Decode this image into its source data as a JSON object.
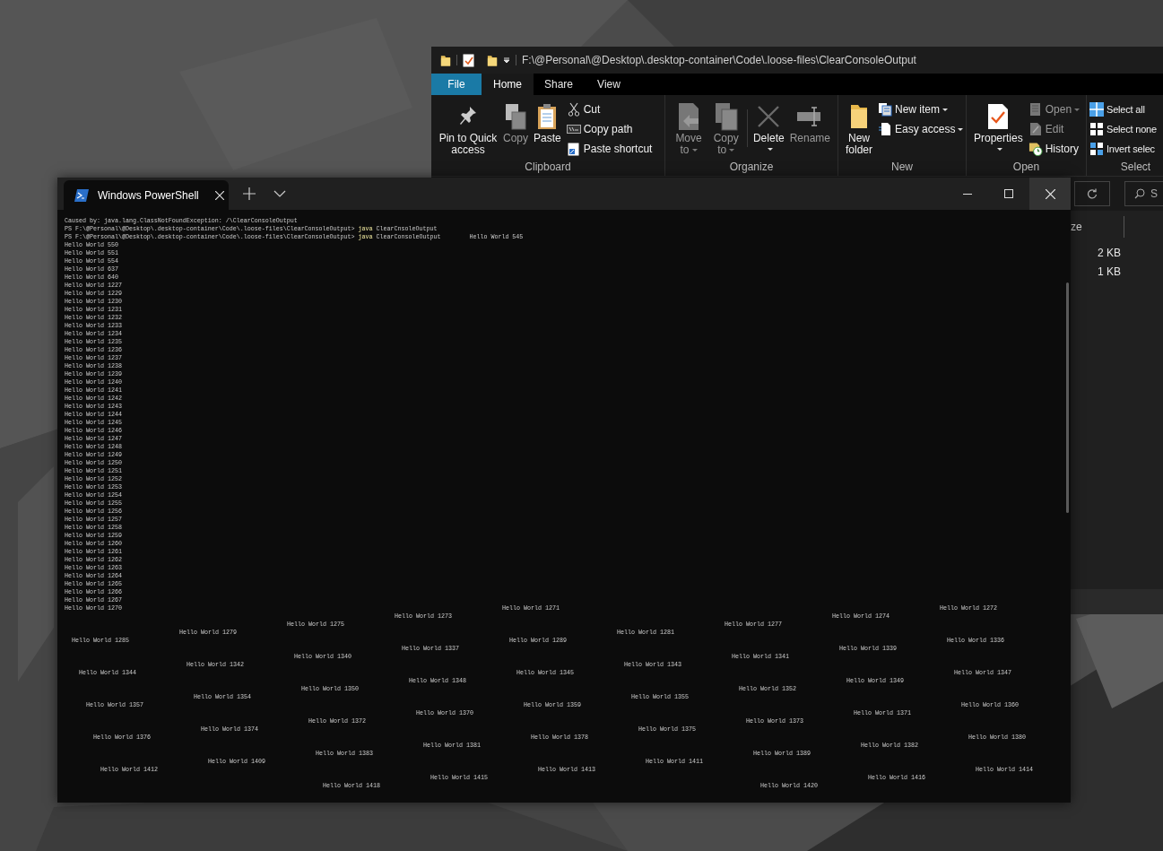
{
  "explorer": {
    "address": "F:\\@Personal\\@Desktop\\.desktop-container\\Code\\.loose-files\\ClearConsoleOutput",
    "tabs": [
      {
        "label": "File",
        "kind": "file",
        "selected": false
      },
      {
        "label": "Home",
        "kind": "tab",
        "selected": true
      },
      {
        "label": "Share",
        "kind": "tab",
        "selected": false
      },
      {
        "label": "View",
        "kind": "tab",
        "selected": false
      }
    ],
    "groups": [
      {
        "label": "Clipboard",
        "items": [
          {
            "label": "Pin to Quick access",
            "kind": "large",
            "disabled": false
          },
          {
            "label": "Copy",
            "kind": "large",
            "disabled": true
          },
          {
            "label": "Paste",
            "kind": "large",
            "disabled": false
          },
          {
            "label": "Cut",
            "kind": "small",
            "disabled": false
          },
          {
            "label": "Copy path",
            "kind": "small",
            "disabled": false
          },
          {
            "label": "Paste shortcut",
            "kind": "small",
            "disabled": false
          }
        ]
      },
      {
        "label": "Organize",
        "items": [
          {
            "label": "Move to",
            "kind": "large",
            "disabled": true,
            "dropdown": true
          },
          {
            "label": "Copy to",
            "kind": "large",
            "disabled": true,
            "dropdown": true
          },
          {
            "label": "Delete",
            "kind": "large",
            "disabled": false,
            "dropdown_below": true,
            "divider_before": true
          },
          {
            "label": "Rename",
            "kind": "large",
            "disabled": true
          }
        ]
      },
      {
        "label": "New",
        "items": [
          {
            "label": "New folder",
            "kind": "large",
            "disabled": false
          },
          {
            "label": "New item",
            "kind": "small",
            "disabled": false,
            "dropdown": true
          },
          {
            "label": "Easy access",
            "kind": "small",
            "disabled": false,
            "dropdown": true
          }
        ]
      },
      {
        "label": "Open",
        "items": [
          {
            "label": "Properties",
            "kind": "large",
            "disabled": false,
            "dropdown_below": true
          },
          {
            "label": "Open",
            "kind": "small",
            "disabled": true,
            "dropdown": true
          },
          {
            "label": "Edit",
            "kind": "small",
            "disabled": true
          },
          {
            "label": "History",
            "kind": "small",
            "disabled": false
          }
        ]
      },
      {
        "label": "Select",
        "items": [
          {
            "label": "Select all",
            "kind": "small",
            "disabled": false
          },
          {
            "label": "Select none",
            "kind": "small",
            "disabled": false
          },
          {
            "label": "Invert selec",
            "kind": "small",
            "disabled": false
          }
        ]
      }
    ],
    "search_placeholder": "S",
    "column_header": "ze",
    "sizes": [
      "2 KB",
      "1 KB"
    ]
  },
  "terminal": {
    "tab_title": "Windows PowerShell",
    "lines": [
      {
        "kind": "text",
        "text": "Caused by: java.lang.ClassNotFoundException: /\\ClearConsoleOutput"
      },
      {
        "kind": "prompt",
        "prompt": "PS F:\\@Personal\\@Desktop\\.desktop-container\\Code\\.loose-files\\ClearConsoleOutput>",
        "command": "java",
        "args": "ClearCnsoleOutput"
      },
      {
        "kind": "prompt",
        "prompt": "PS F:\\@Personal\\@Desktop\\.desktop-container\\Code\\.loose-files\\ClearConsoleOutput>",
        "command": "java",
        "args": "ClearConsoleOutput",
        "trailing": "Hello World 545"
      },
      {
        "kind": "text",
        "text": "Hello World 550"
      },
      {
        "kind": "text",
        "text": "Hello World 551"
      },
      {
        "kind": "text",
        "text": "Hello World 554"
      },
      {
        "kind": "text",
        "text": "Hello World 637"
      },
      {
        "kind": "text",
        "text": "Hello World 640"
      },
      {
        "kind": "text",
        "text": "Hello World 1227"
      },
      {
        "kind": "text",
        "text": "Hello World 1229"
      },
      {
        "kind": "text",
        "text": "Hello World 1230"
      },
      {
        "kind": "text",
        "text": "Hello World 1231"
      },
      {
        "kind": "text",
        "text": "Hello World 1232"
      },
      {
        "kind": "text",
        "text": "Hello World 1233"
      },
      {
        "kind": "text",
        "text": "Hello World 1234"
      },
      {
        "kind": "text",
        "text": "Hello World 1235"
      },
      {
        "kind": "text",
        "text": "Hello World 1236"
      },
      {
        "kind": "text",
        "text": "Hello World 1237"
      },
      {
        "kind": "text",
        "text": "Hello World 1238"
      },
      {
        "kind": "text",
        "text": "Hello World 1239"
      },
      {
        "kind": "text",
        "text": "Hello World 1240"
      },
      {
        "kind": "text",
        "text": "Hello World 1241"
      },
      {
        "kind": "text",
        "text": "Hello World 1242"
      },
      {
        "kind": "text",
        "text": "Hello World 1243"
      },
      {
        "kind": "text",
        "text": "Hello World 1244"
      },
      {
        "kind": "text",
        "text": "Hello World 1245"
      },
      {
        "kind": "text",
        "text": "Hello World 1246"
      },
      {
        "kind": "text",
        "text": "Hello World 1247"
      },
      {
        "kind": "text",
        "text": "Hello World 1248"
      },
      {
        "kind": "text",
        "text": "Hello World 1249"
      },
      {
        "kind": "text",
        "text": "Hello World 1250"
      },
      {
        "kind": "text",
        "text": "Hello World 1251"
      },
      {
        "kind": "text",
        "text": "Hello World 1252"
      },
      {
        "kind": "text",
        "text": "Hello World 1253"
      },
      {
        "kind": "text",
        "text": "Hello World 1254"
      },
      {
        "kind": "text",
        "text": "Hello World 1255"
      },
      {
        "kind": "text",
        "text": "Hello World 1256"
      },
      {
        "kind": "text",
        "text": "Hello World 1257"
      },
      {
        "kind": "text",
        "text": "Hello World 1258"
      },
      {
        "kind": "text",
        "text": "Hello World 1259"
      },
      {
        "kind": "text",
        "text": "Hello World 1260"
      },
      {
        "kind": "text",
        "text": "Hello World 1261"
      },
      {
        "kind": "text",
        "text": "Hello World 1262"
      },
      {
        "kind": "text",
        "text": "Hello World 1263"
      },
      {
        "kind": "text",
        "text": "Hello World 1264"
      },
      {
        "kind": "text",
        "text": "Hello World 1265"
      },
      {
        "kind": "text",
        "text": "Hello World 1266"
      },
      {
        "kind": "text",
        "text": "Hello World 1267"
      },
      {
        "kind": "text",
        "text": "Hello World 1270"
      }
    ],
    "scattered_columns": [
      [
        "Hello World 1285",
        "Hello World 1344",
        "Hello World 1357",
        "Hello World 1376",
        "Hello World 1412"
      ],
      [
        "Hello World 1279",
        "Hello World 1342",
        "Hello World 1354",
        "Hello World 1374",
        "Hello World 1409"
      ],
      [
        "Hello World 1275",
        "Hello World 1340",
        "Hello World 1350",
        "Hello World 1372",
        "Hello World 1383",
        "Hello World 1418"
      ],
      [
        "Hello World 1273",
        "Hello World 1337",
        "Hello World 1348",
        "Hello World 1370",
        "Hello World 1381",
        "Hello World 1415"
      ],
      [
        "Hello World 1271",
        "Hello World 1289",
        "Hello World 1345",
        "Hello World 1359",
        "Hello World 1378",
        "Hello World 1413"
      ],
      [
        "Hello World 1281",
        "Hello World 1343",
        "Hello World 1355",
        "Hello World 1375",
        "Hello World 1411"
      ],
      [
        "Hello World 1277",
        "Hello World 1341",
        "Hello World 1352",
        "Hello World 1373",
        "Hello World 1389",
        "Hello World 1420"
      ],
      [
        "Hello World 1274",
        "Hello World 1339",
        "Hello World 1349",
        "Hello World 1371",
        "Hello World 1382",
        "Hello World 1416"
      ],
      [
        "Hello World 1272",
        "Hello World 1336",
        "Hello World 1347",
        "Hello World 1360",
        "Hello World 1380",
        "Hello World 1414"
      ]
    ]
  }
}
